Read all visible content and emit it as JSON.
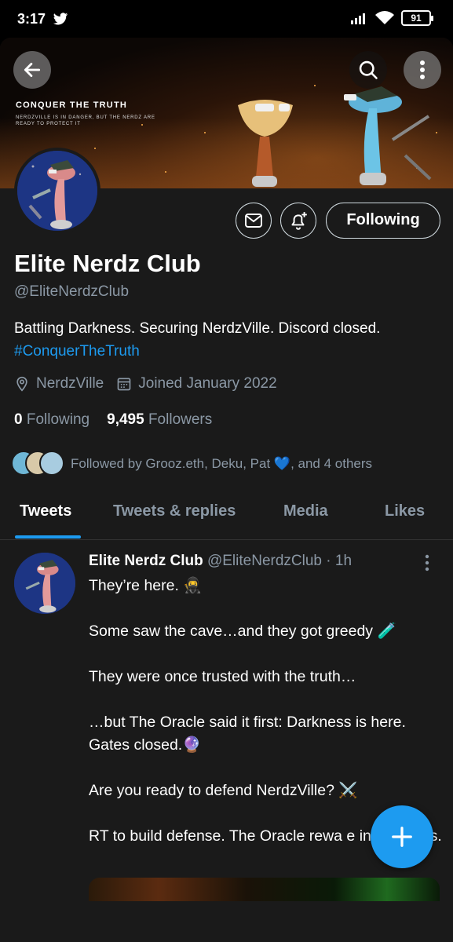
{
  "status_bar": {
    "time": "3:17",
    "battery": "91"
  },
  "banner": {
    "title": "CONQUER THE TRUTH",
    "subtitle": "NERDZVILLE IS IN DANGER, BUT THE NERDZ ARE READY TO PROTECT IT"
  },
  "profile": {
    "name": "Elite Nerdz Club",
    "handle": "@EliteNerdzClub",
    "bio": "Battling Darkness. Securing NerdzVille. Discord closed.",
    "bio_hashtag": "#ConquerTheTruth",
    "location": "NerdzVille",
    "joined": "Joined January 2022",
    "following_count": "0",
    "following_label": "Following",
    "followers_count": "9,495",
    "followers_label": "Followers",
    "followed_by": "Followed by Grooz.eth, Deku, Pat 💙, and 4 others",
    "follow_button": "Following"
  },
  "tabs": [
    {
      "label": "Tweets",
      "active": true
    },
    {
      "label": "Tweets & replies",
      "active": false
    },
    {
      "label": "Media",
      "active": false
    },
    {
      "label": "Likes",
      "active": false
    }
  ],
  "tweet": {
    "name": "Elite Nerdz Club",
    "handle": "@EliteNerdzClub",
    "time": "· 1h",
    "lines": [
      "They’re here. 🥷",
      "Some saw the cave…and they got greedy 🧪",
      "They were once trusted with the truth…",
      "…but The Oracle said it first: Darkness is here. Gates closed.🔮",
      "Are you ready to defend NerdzVille? ⚔️",
      "RT to build defense. The Oracle rewa   e interactions."
    ]
  },
  "colors": {
    "accent": "#1d9bf0",
    "background": "#1a1a1a",
    "muted_text": "#8b98a5"
  }
}
